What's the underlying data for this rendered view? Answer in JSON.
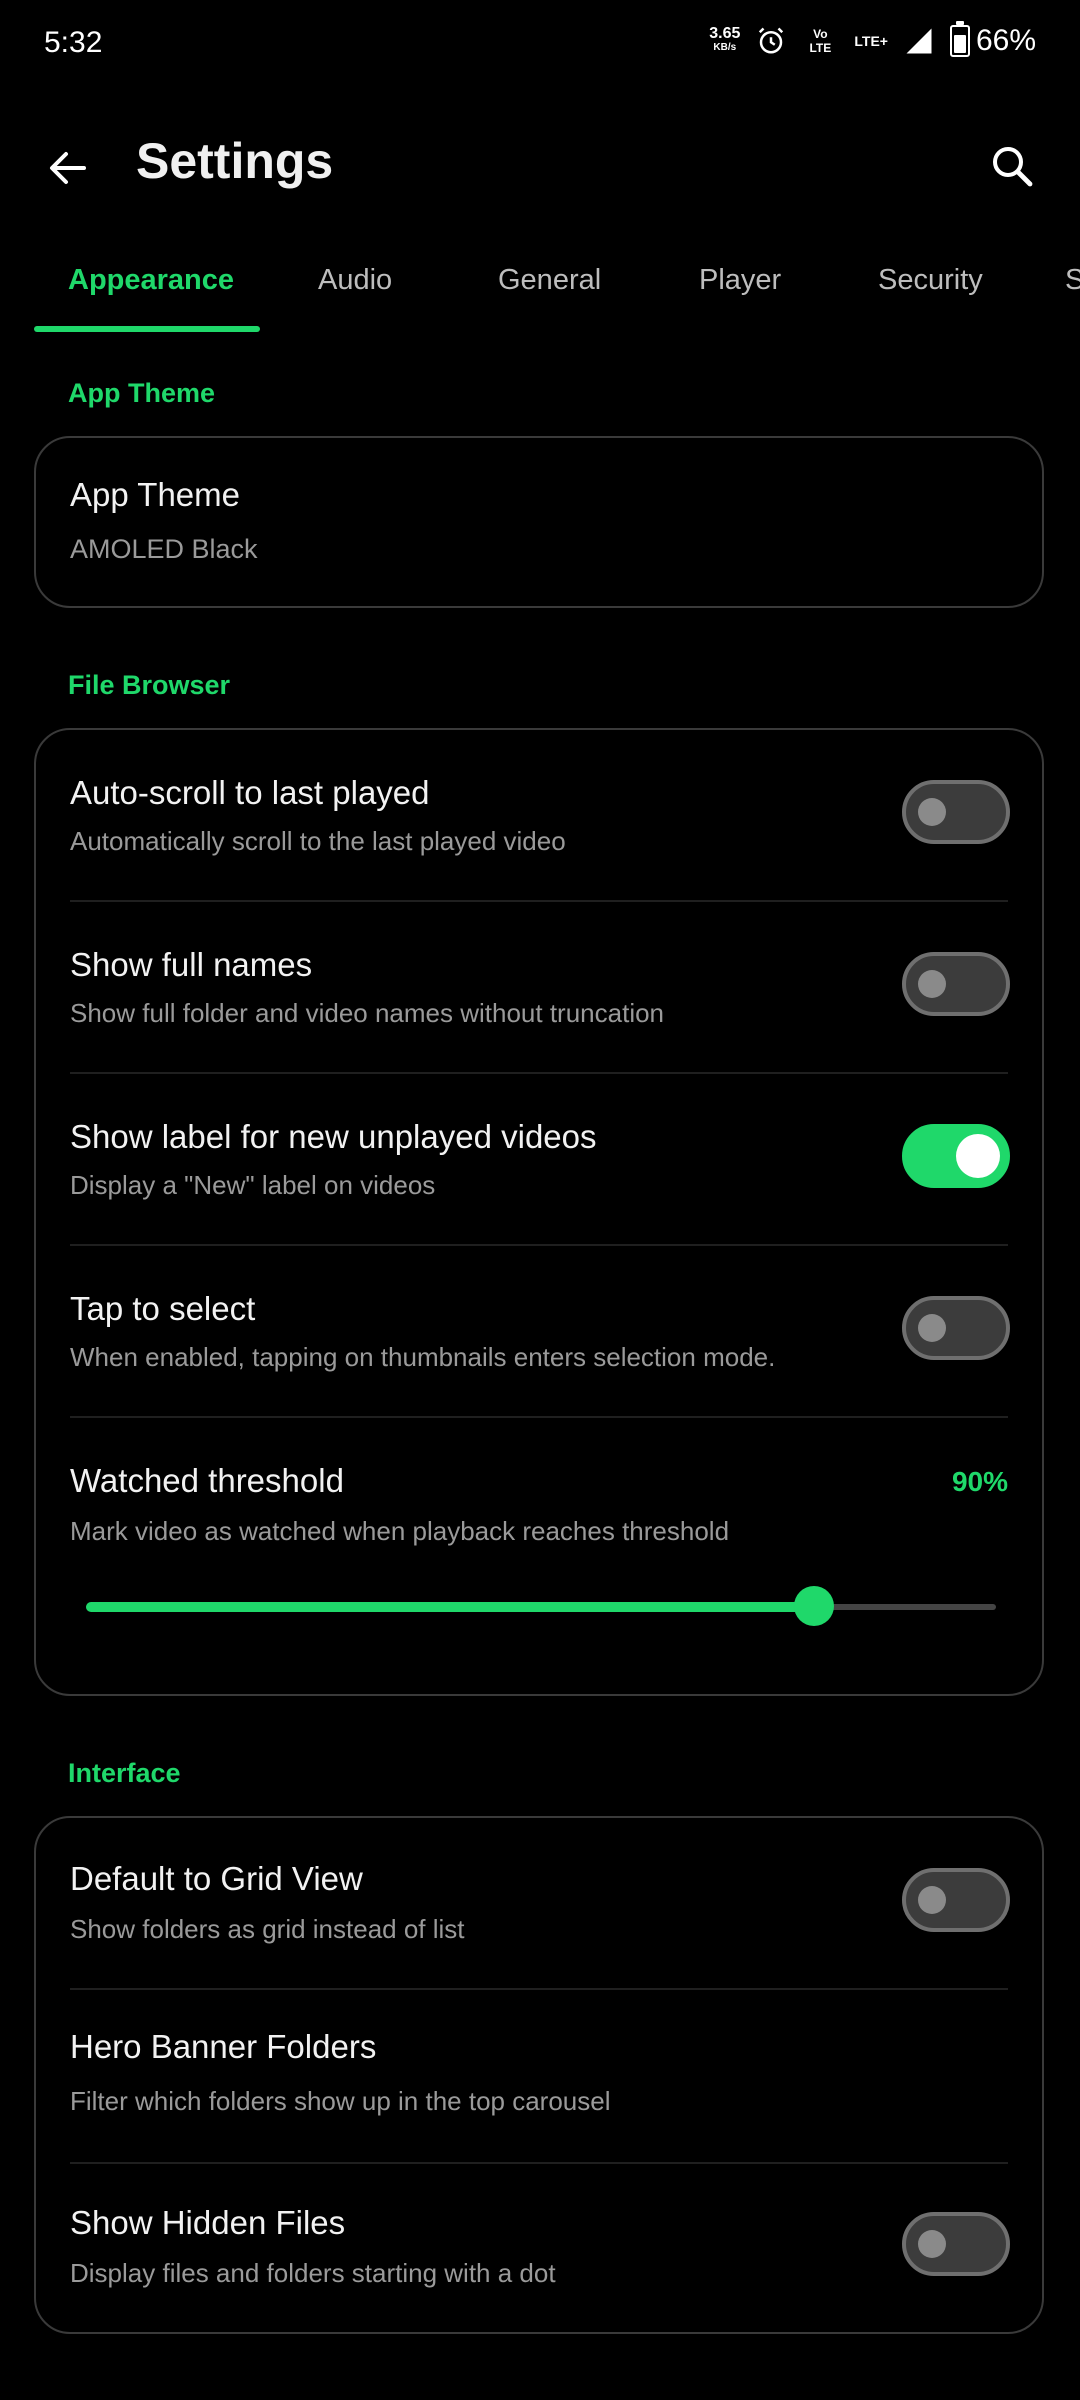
{
  "status_bar": {
    "time": "5:32",
    "net_speed": "3.65",
    "net_unit": "KB/s",
    "volte": "Vo LTE",
    "lte": "LTE+",
    "battery": "66%",
    "battery_level": 0.66
  },
  "app_bar": {
    "title": "Settings",
    "back_icon": "arrow-back-icon",
    "search_icon": "search-icon"
  },
  "tabs": [
    {
      "label": "Appearance",
      "active": true
    },
    {
      "label": "Audio"
    },
    {
      "label": "General"
    },
    {
      "label": "Player"
    },
    {
      "label": "Security"
    },
    {
      "label": "S"
    }
  ],
  "sections": {
    "app_theme": {
      "title": "App Theme",
      "item": {
        "title": "App Theme",
        "value": "AMOLED Black"
      }
    },
    "file_browser": {
      "title": "File Browser",
      "items": [
        {
          "title": "Auto-scroll to last played",
          "subtitle": "Automatically scroll to the last played video",
          "enabled": false
        },
        {
          "title": "Show full names",
          "subtitle": "Show full folder and video names without truncation",
          "enabled": false
        },
        {
          "title": "Show label for new unplayed videos",
          "subtitle": "Display a \"New\" label on videos",
          "enabled": true
        },
        {
          "title": "Tap to select",
          "subtitle": "When enabled, tapping on thumbnails enters selection mode.",
          "enabled": false
        }
      ],
      "threshold": {
        "title": "Watched threshold",
        "subtitle": "Mark video as watched when playback reaches threshold",
        "value_label": "90%",
        "value": 0.8
      }
    },
    "interface": {
      "title": "Interface",
      "items": [
        {
          "title": "Default to Grid View",
          "subtitle": "Show folders as grid instead of list",
          "enabled": false
        },
        {
          "title": "Hero Banner Folders",
          "subtitle": "Filter which folders show up in the top carousel"
        },
        {
          "title": "Show Hidden Files",
          "subtitle": "Display files and folders starting with a dot",
          "enabled": false
        }
      ]
    }
  },
  "colors": {
    "accent": "#1fd86a",
    "background": "#000000",
    "card_border": "#3a3a3a"
  }
}
